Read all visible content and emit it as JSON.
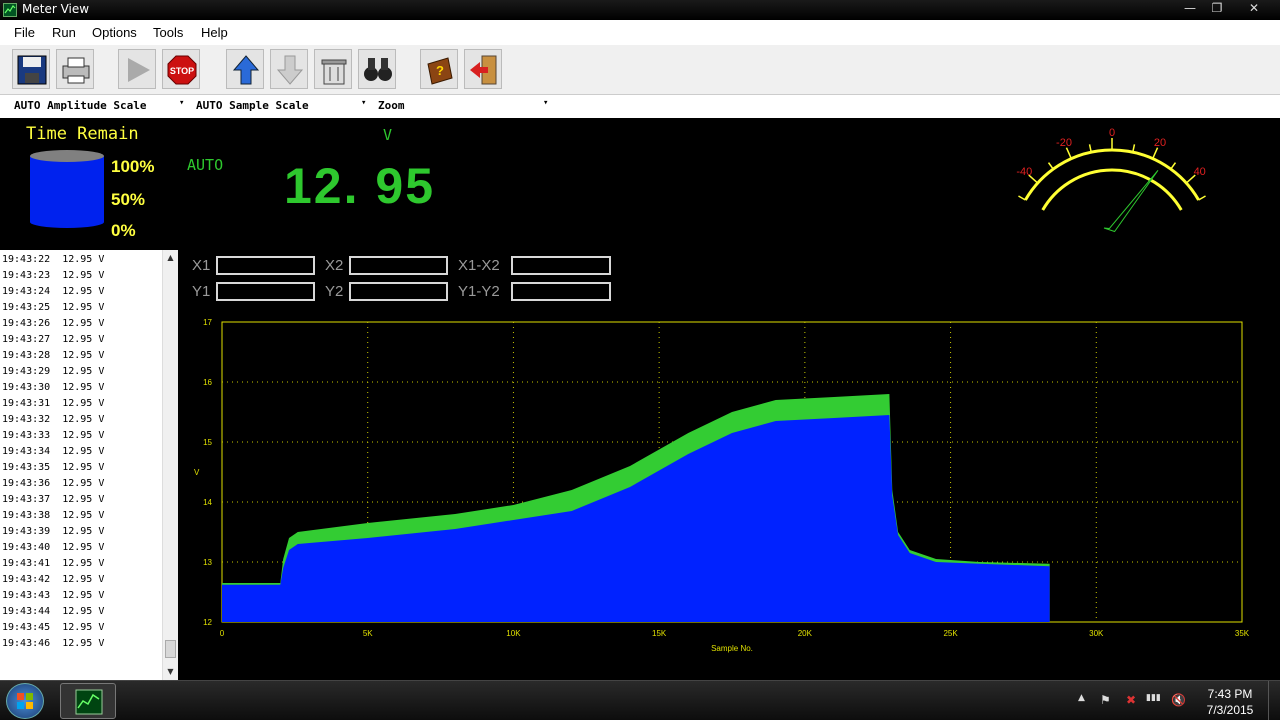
{
  "window": {
    "title": "Meter View",
    "minimize": "—",
    "maximize": "❐",
    "close": "✕"
  },
  "menu": [
    "File",
    "Run",
    "Options",
    "Tools",
    "Help"
  ],
  "toolbar": [
    {
      "name": "save-icon"
    },
    {
      "name": "print-icon"
    },
    {
      "name": "play-icon",
      "enabled": false
    },
    {
      "name": "stop-icon",
      "label": "STOP"
    },
    {
      "name": "upload-arrow-icon"
    },
    {
      "name": "download-arrow-icon",
      "enabled": false
    },
    {
      "name": "trash-icon"
    },
    {
      "name": "binoculars-icon"
    },
    {
      "name": "help-book-icon"
    },
    {
      "name": "exit-icon"
    }
  ],
  "scales": {
    "amplitude": "AUTO Amplitude Scale",
    "sample": "AUTO Sample Scale",
    "zoom": "Zoom",
    "arrow": "▾"
  },
  "meter": {
    "time_remain_label": "Time Remain",
    "levels": [
      "100%",
      "50%",
      "0%"
    ],
    "mode": "AUTO",
    "unit": "V",
    "reading": "12. 95"
  },
  "gauge": {
    "ticks": [
      "-40",
      "-20",
      "0",
      "20",
      "40"
    ],
    "needle_value": 25,
    "range": [
      -50,
      50
    ]
  },
  "log": {
    "entries": [
      "19:43:22  12.95 V",
      "19:43:23  12.95 V",
      "19:43:24  12.95 V",
      "19:43:25  12.95 V",
      "19:43:26  12.95 V",
      "19:43:27  12.95 V",
      "19:43:28  12.95 V",
      "19:43:29  12.95 V",
      "19:43:30  12.95 V",
      "19:43:31  12.95 V",
      "19:43:32  12.95 V",
      "19:43:33  12.95 V",
      "19:43:34  12.95 V",
      "19:43:35  12.95 V",
      "19:43:36  12.95 V",
      "19:43:37  12.95 V",
      "19:43:38  12.95 V",
      "19:43:39  12.95 V",
      "19:43:40  12.95 V",
      "19:43:41  12.95 V",
      "19:43:42  12.95 V",
      "19:43:43  12.95 V",
      "19:43:44  12.95 V",
      "19:43:45  12.95 V",
      "19:43:46  12.95 V"
    ],
    "scroll_up": "▲",
    "scroll_down": "▼"
  },
  "cursors": {
    "x1": "X1",
    "x2": "X2",
    "x1x2": "X1-X2",
    "y1": "Y1",
    "y2": "Y2",
    "y1y2": "Y1-Y2",
    "x1_value": "",
    "x2_value": "",
    "x1x2_value": "",
    "y1_value": "",
    "y2_value": "",
    "y1y2_value": ""
  },
  "chart_data": {
    "type": "area",
    "xlabel": "Sample No.",
    "ylabel": "V",
    "xlim": [
      0,
      35000
    ],
    "ylim": [
      12,
      17
    ],
    "x_ticks": [
      "0",
      "5K",
      "10K",
      "15K",
      "20K",
      "25K",
      "30K",
      "35K"
    ],
    "y_ticks": [
      "12",
      "13",
      "14",
      "15",
      "16",
      "17"
    ],
    "grid": true,
    "colors": {
      "fill": "#0022ff",
      "max_band": "#33cc33",
      "axis": "#e0e000",
      "grid": "#c8c800"
    },
    "series": [
      {
        "name": "max",
        "x": [
          0,
          2000,
          2100,
          2300,
          2600,
          5000,
          8000,
          10000,
          12000,
          14000,
          16000,
          17500,
          19000,
          21000,
          22900,
          23000,
          23200,
          23600,
          24500,
          26000,
          28400
        ],
        "values": [
          12.65,
          12.65,
          13.05,
          13.4,
          13.5,
          13.65,
          13.8,
          13.95,
          14.2,
          14.6,
          15.15,
          15.5,
          15.7,
          15.75,
          15.8,
          14.2,
          13.5,
          13.2,
          13.05,
          13.0,
          12.97
        ]
      },
      {
        "name": "min",
        "x": [
          0,
          2000,
          2100,
          2300,
          2600,
          5000,
          8000,
          10000,
          12000,
          14000,
          16000,
          17500,
          19000,
          21000,
          22900,
          23000,
          23200,
          23600,
          24500,
          26000,
          28400
        ],
        "values": [
          12.62,
          12.62,
          12.9,
          13.2,
          13.3,
          13.4,
          13.55,
          13.7,
          13.85,
          14.25,
          14.8,
          15.15,
          15.35,
          15.4,
          15.45,
          14.1,
          13.45,
          13.15,
          13.0,
          12.97,
          12.93
        ]
      }
    ]
  },
  "taskbar": {
    "time": "7:43 PM",
    "date": "7/3/2015",
    "tray": [
      "▲",
      "⚑",
      "✖",
      "▮▮▮",
      "🔇"
    ]
  }
}
